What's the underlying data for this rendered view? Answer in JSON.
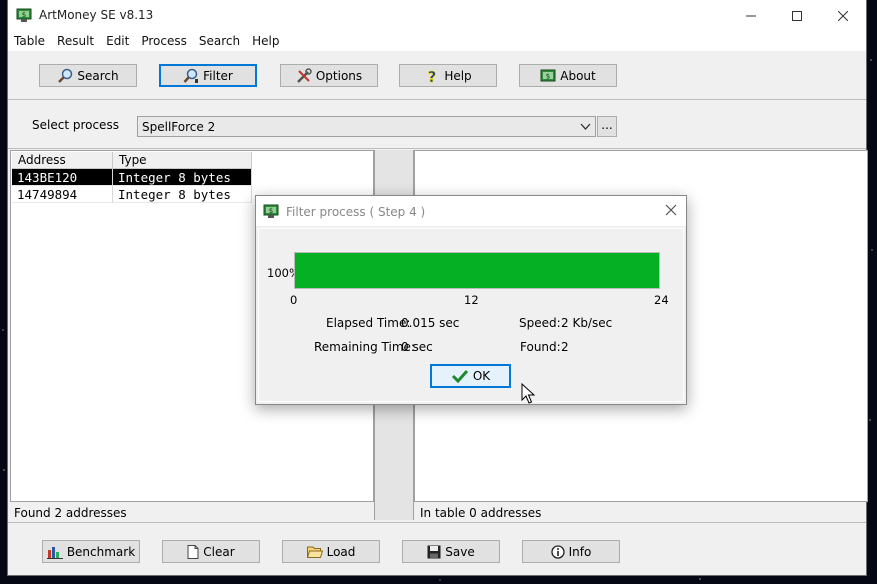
{
  "window": {
    "title": "ArtMoney SE v8.13"
  },
  "menu": [
    "Table",
    "Result",
    "Edit",
    "Process",
    "Search",
    "Help"
  ],
  "toolbar": {
    "search": "Search",
    "filter": "Filter",
    "options": "Options",
    "help": "Help",
    "about": "About"
  },
  "process": {
    "label": "Select process",
    "value": "SpellForce 2",
    "browse": "..."
  },
  "results": {
    "columns": [
      "Address",
      "Type"
    ],
    "rows": [
      {
        "address": "143BE120",
        "type": "Integer 8 bytes",
        "selected": true
      },
      {
        "address": "14749894",
        "type": "Integer 8 bytes",
        "selected": false
      }
    ],
    "status": "Found 2 addresses"
  },
  "table": {
    "status": "In table 0 addresses"
  },
  "bottom": {
    "benchmark": "Benchmark",
    "clear": "Clear",
    "load": "Load",
    "save": "Save",
    "info": "Info"
  },
  "dialog": {
    "title": "Filter process ( Step 4 )",
    "percent_label": "100%",
    "progress": 1.0,
    "progress_color": "#06b025",
    "ticks": [
      "0",
      "12",
      "24"
    ],
    "elapsed_label": "Elapsed Time:",
    "elapsed_value": "0.015 sec",
    "remaining_label": "Remaining Time:",
    "remaining_value": "0 sec",
    "speed_label": "Speed:",
    "speed_value": "2 Kb/sec",
    "found_label": "Found:",
    "found_value": "2",
    "ok": "OK"
  },
  "icons": {
    "app": "artmoney-icon",
    "search": "magnifier-icon",
    "filter": "filter-magnifier-icon",
    "options": "tools-icon",
    "help": "question-icon",
    "about": "info-window-icon",
    "ok": "checkmark-icon"
  }
}
